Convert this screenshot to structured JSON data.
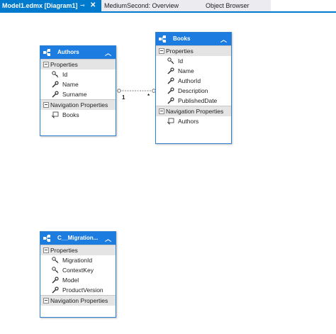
{
  "tabs": [
    {
      "label": "Model1.edmx [Diagram1]",
      "pin": "⊸",
      "close": "✕"
    },
    {
      "label": "MediumSecond: Overview"
    },
    {
      "label": "Object Browser"
    }
  ],
  "colors": {
    "accent": "#007acc",
    "entity_header": "#1c7ce0"
  },
  "entities": {
    "authors": {
      "name": "Authors",
      "properties_label": "Properties",
      "properties": [
        "Id",
        "Name",
        "Surname"
      ],
      "nav_label": "Navigation Properties",
      "navigation": [
        "Books"
      ]
    },
    "books": {
      "name": "Books",
      "properties_label": "Properties",
      "properties": [
        "Id",
        "Name",
        "AuthorId",
        "Description",
        "PublishedDate"
      ],
      "nav_label": "Navigation Properties",
      "navigation": [
        "Authors"
      ]
    },
    "migration": {
      "name": "C__Migration...",
      "properties_label": "Properties",
      "properties": [
        "MigrationId",
        "ContextKey",
        "Model",
        "ProductVersion"
      ],
      "nav_label": "Navigation Properties",
      "navigation": []
    }
  },
  "association": {
    "left_multiplicity": "1",
    "right_multiplicity": "*"
  }
}
